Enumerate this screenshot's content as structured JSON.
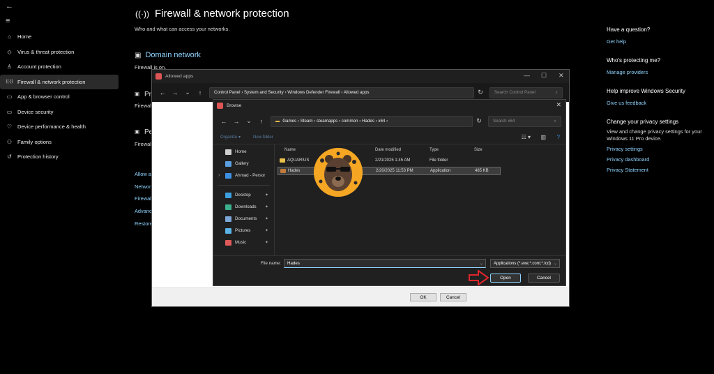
{
  "sidebar": {
    "back_glyph": "←",
    "menu_glyph": "≡",
    "items": [
      {
        "label": "Home",
        "icon": "home-icon",
        "glyph": "⌂"
      },
      {
        "label": "Virus & threat protection",
        "icon": "shield-icon",
        "glyph": "◇"
      },
      {
        "label": "Account protection",
        "icon": "person-icon",
        "glyph": "♙"
      },
      {
        "label": "Firewall & network protection",
        "icon": "wireless-icon",
        "glyph": "((·))",
        "active": true
      },
      {
        "label": "App & browser control",
        "icon": "window-icon",
        "glyph": "▭"
      },
      {
        "label": "Device security",
        "icon": "laptop-icon",
        "glyph": "▭"
      },
      {
        "label": "Device performance & health",
        "icon": "heart-icon",
        "glyph": "♡"
      },
      {
        "label": "Family options",
        "icon": "family-icon",
        "glyph": "⚇"
      },
      {
        "label": "Protection history",
        "icon": "history-icon",
        "glyph": "↺"
      }
    ]
  },
  "page": {
    "title": "Firewall & network protection",
    "subtitle": "Who and what can access your networks.",
    "domain_title": "Domain network",
    "domain_status": "Firewall is on.",
    "partial_labels": [
      "Firewal",
      "Pr",
      "Firewal",
      "Pe",
      "Firewal"
    ],
    "partial_links": [
      "Allow a",
      "Networ",
      "Firewal",
      "Advanc",
      "Restore"
    ]
  },
  "right_panel": {
    "question_title": "Have a question?",
    "question_link": "Get help",
    "protecting_title": "Who's protecting me?",
    "protecting_link": "Manage providers",
    "improve_title": "Help improve Windows Security",
    "improve_link": "Give us feedback",
    "privacy_title": "Change your privacy settings",
    "privacy_text": "View and change privacy settings for your Windows 11 Pro device.",
    "privacy_links": [
      "Privacy settings",
      "Privacy dashboard",
      "Privacy Statement"
    ]
  },
  "allowed_apps": {
    "title": "Allowed apps",
    "address": "Control Panel  ›  System and Security  ›  Windows Defender Firewall  ›  Allowed apps",
    "search_placeholder": "Search Control Panel",
    "ok_label": "OK",
    "cancel_label": "Cancel"
  },
  "browse": {
    "title": "Browse",
    "address": "Games  ›  Steam  ›  steamapps  ›  common  ›  Hades  ›  x64  ›",
    "search_placeholder": "Search x64",
    "organize_label": "Organize ▾",
    "newfolder_label": "New folder",
    "columns": {
      "name": "Name",
      "date": "Date modified",
      "type": "Type",
      "size": "Size"
    },
    "files": [
      {
        "name": "AQUARIUS",
        "date": "2/21/2025 1:45 AM",
        "type": "File folder",
        "size": "",
        "icon": "folder-icon"
      },
      {
        "name": "Hades",
        "date": "2/20/2025 11:53 PM",
        "type": "Application",
        "size": "485 KB",
        "icon": "app-icon",
        "selected": true
      }
    ],
    "nav_items": [
      {
        "label": "Home",
        "icon": "home-icon",
        "color": "#cfcfcf"
      },
      {
        "label": "Gallery",
        "icon": "gallery-icon",
        "color": "#5aa0e0"
      },
      {
        "label": "Ahmad - Persor",
        "icon": "cloud-icon",
        "color": "#3c8fe0",
        "chevron": true
      }
    ],
    "quick_items": [
      {
        "label": "Desktop",
        "icon": "desktop-icon",
        "color": "#3ca0e0"
      },
      {
        "label": "Downloads",
        "icon": "downloads-icon",
        "color": "#3cb08c"
      },
      {
        "label": "Documents",
        "icon": "documents-icon",
        "color": "#7da7d9"
      },
      {
        "label": "Pictures",
        "icon": "pictures-icon",
        "color": "#5ab4e8"
      },
      {
        "label": "Music",
        "icon": "music-icon",
        "color": "#e05a5a"
      }
    ],
    "filename_label": "File name:",
    "filename_value": "Hades",
    "filetype_value": "Applications (*.exe;*.com;*.icd)",
    "open_label": "Open",
    "cancel_label": "Cancel"
  }
}
